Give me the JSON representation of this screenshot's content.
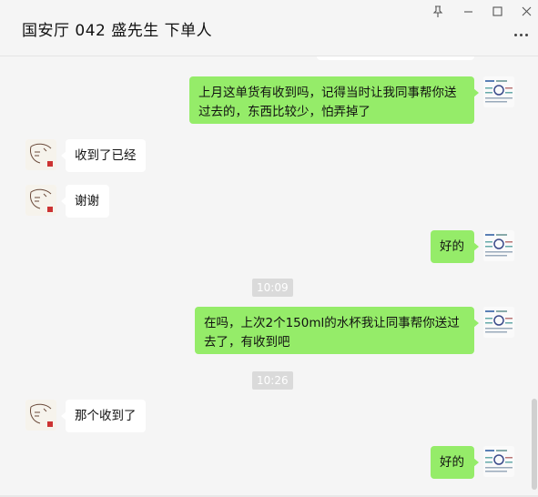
{
  "window": {
    "title": "国安厅 042 盛先生 下单人",
    "pin_icon": "pin-icon",
    "minimize_icon": "minimize-icon",
    "maximize_icon": "maximize-icon",
    "close_icon": "close-icon",
    "more_icon": "more-icon"
  },
  "messages": [
    {
      "side": "me",
      "text": "上月这单货有收到吗，记得当时让我同事帮你送过去的，东西比较少，怕弄掉了"
    },
    {
      "side": "them",
      "text": "收到了已经"
    },
    {
      "side": "them",
      "text": "谢谢"
    },
    {
      "side": "me",
      "text": "好的"
    },
    {
      "type": "time",
      "text": "10:09"
    },
    {
      "side": "me",
      "text": "在吗，上次2个150ml的水杯我让同事帮你送过去了，有收到吧"
    },
    {
      "type": "time",
      "text": "10:26"
    },
    {
      "side": "them",
      "text": "那个收到了"
    },
    {
      "side": "me",
      "text": "好的"
    }
  ],
  "colors": {
    "my_bubble": "#95ec69",
    "their_bubble": "#ffffff",
    "background": "#f5f5f5",
    "timestamp_bg": "#dadada"
  }
}
